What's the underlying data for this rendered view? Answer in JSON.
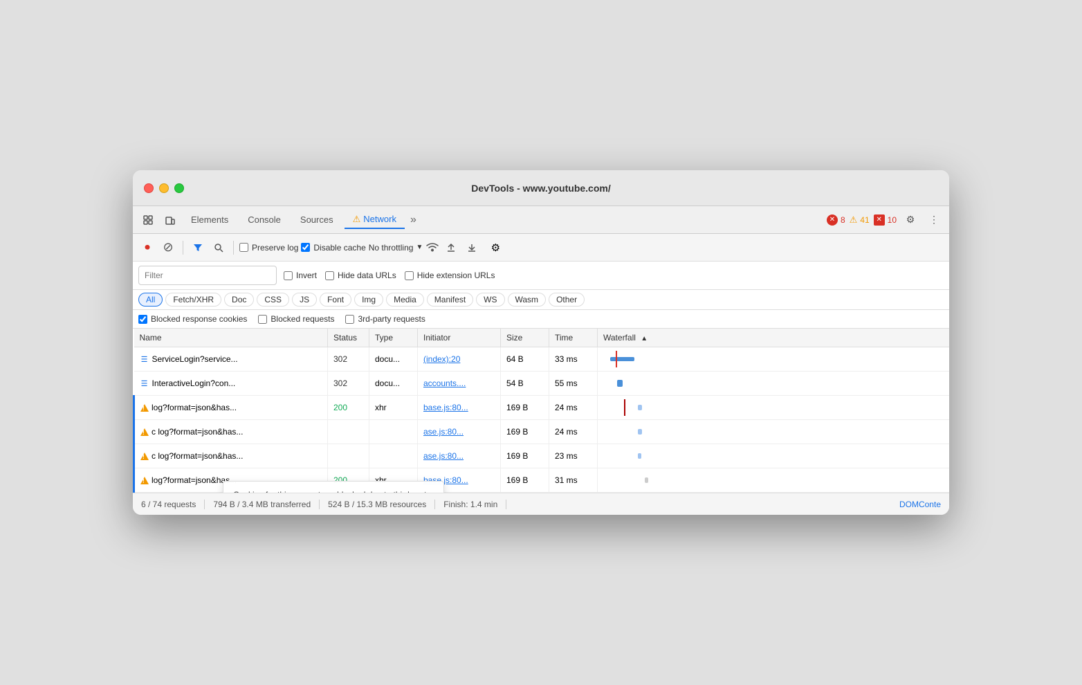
{
  "window": {
    "title": "DevTools - www.youtube.com/"
  },
  "tabs": [
    {
      "id": "elements",
      "label": "Elements",
      "active": false
    },
    {
      "id": "console",
      "label": "Console",
      "active": false
    },
    {
      "id": "sources",
      "label": "Sources",
      "active": false
    },
    {
      "id": "network",
      "label": "Network",
      "active": true,
      "warning": true
    },
    {
      "id": "more",
      "label": ">>",
      "active": false
    }
  ],
  "badges": {
    "errors": "8",
    "warnings": "41",
    "issues": "10"
  },
  "toolbar": {
    "preserve_log_label": "Preserve log",
    "disable_cache_label": "Disable cache",
    "throttle_label": "No throttling"
  },
  "filter": {
    "placeholder": "Filter",
    "invert_label": "Invert",
    "hide_data_urls_label": "Hide data URLs",
    "hide_extension_urls_label": "Hide extension URLs"
  },
  "type_filters": [
    {
      "id": "all",
      "label": "All",
      "active": true
    },
    {
      "id": "fetch-xhr",
      "label": "Fetch/XHR",
      "active": false
    },
    {
      "id": "doc",
      "label": "Doc",
      "active": false
    },
    {
      "id": "css",
      "label": "CSS",
      "active": false
    },
    {
      "id": "js",
      "label": "JS",
      "active": false
    },
    {
      "id": "font",
      "label": "Font",
      "active": false
    },
    {
      "id": "img",
      "label": "Img",
      "active": false
    },
    {
      "id": "media",
      "label": "Media",
      "active": false
    },
    {
      "id": "manifest",
      "label": "Manifest",
      "active": false
    },
    {
      "id": "ws",
      "label": "WS",
      "active": false
    },
    {
      "id": "wasm",
      "label": "Wasm",
      "active": false
    },
    {
      "id": "other",
      "label": "Other",
      "active": false
    }
  ],
  "cookie_filters": {
    "blocked_response_cookies_label": "Blocked response cookies",
    "blocked_requests_label": "Blocked requests",
    "third_party_requests_label": "3rd-party requests"
  },
  "table": {
    "columns": [
      "Name",
      "Status",
      "Type",
      "Initiator",
      "Size",
      "Time",
      "Waterfall"
    ],
    "rows": [
      {
        "icon": "doc",
        "name": "ServiceLogin?service...",
        "status": "302",
        "type": "docu...",
        "initiator": "(index):20",
        "initiator_link": true,
        "size": "64 B",
        "time": "33 ms",
        "highlighted": false
      },
      {
        "icon": "doc",
        "name": "InteractiveLogin?con...",
        "status": "302",
        "type": "docu...",
        "initiator": "accounts....",
        "initiator_link": true,
        "size": "54 B",
        "time": "55 ms",
        "highlighted": false
      },
      {
        "icon": "warn",
        "name": "log?format=json&has...",
        "status": "200",
        "type": "xhr",
        "initiator": "base.js:80...",
        "initiator_link": true,
        "size": "169 B",
        "time": "24 ms",
        "highlighted": true
      },
      {
        "icon": "warn",
        "name": "c log?format=json&has...",
        "status": "",
        "type": "",
        "initiator": "ase.js:80...",
        "initiator_link": true,
        "size": "169 B",
        "time": "24 ms",
        "highlighted": true,
        "tooltip": true
      },
      {
        "icon": "warn",
        "name": "c log?format=json&has...",
        "status": "",
        "type": "",
        "initiator": "ase.js:80...",
        "initiator_link": true,
        "size": "169 B",
        "time": "23 ms",
        "highlighted": true
      },
      {
        "icon": "warn",
        "name": "log?format=json&has...",
        "status": "200",
        "type": "xhr",
        "initiator": "base.js:80...",
        "initiator_link": true,
        "size": "169 B",
        "time": "31 ms",
        "highlighted": true
      }
    ]
  },
  "tooltip": {
    "text": "Cookies for this request are blocked due to third-party cookie phaseout. Learn more in the Issues tab."
  },
  "status_bar": {
    "requests": "6 / 74 requests",
    "transferred": "794 B / 3.4 MB transferred",
    "resources": "524 B / 15.3 MB resources",
    "finish": "Finish: 1.4 min",
    "domconte": "DOMConte"
  }
}
